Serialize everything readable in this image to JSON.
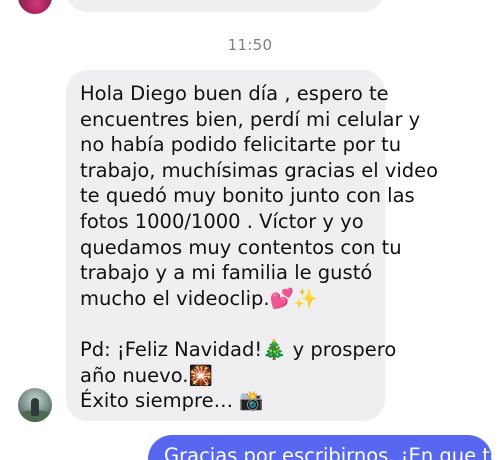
{
  "thread": {
    "timestamp": "11:50",
    "incoming_message": {
      "lines": [
        "Hola Diego buen día , espero te",
        "encuentres bien, perdí mi celular y",
        "no había podido felicitarte por tu",
        "trabajo, muchísimas gracias el video",
        "te quedó muy bonito junto con las",
        "fotos 1000/1000 . Víctor y yo",
        "quedamos muy contentos con tu",
        "trabajo y a mi familia le gustó",
        "mucho el videoclip.💕✨",
        "Pd: ¡Feliz Navidad!🎄 y prospero",
        "año nuevo.🎇",
        "Éxito siempre… 📸"
      ]
    },
    "outgoing_message": {
      "text": "Gracias por escribirnos, ¡En que te"
    }
  }
}
